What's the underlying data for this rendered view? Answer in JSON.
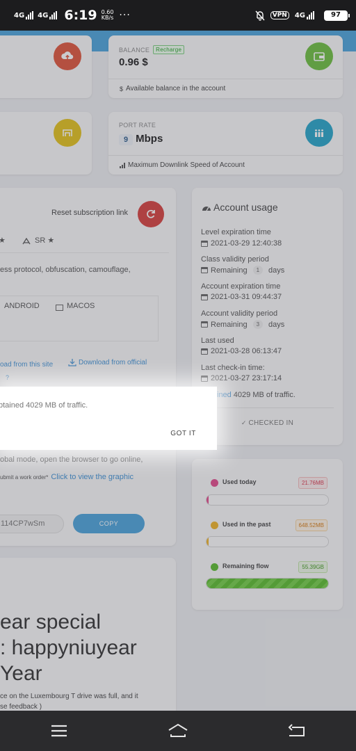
{
  "status_bar": {
    "net1": "4G",
    "net2": "4G",
    "time": "6:19",
    "speed_value": "0.60",
    "speed_unit": "KB/s",
    "more": "···",
    "vpn": "VPN",
    "net3": "4G",
    "battery": "97"
  },
  "cards": {
    "balance": {
      "label": "BALANCE",
      "recharge": "Recharge",
      "value": "0.96 $",
      "foot_icon": "$",
      "foot": "Available balance in the account",
      "icon": "wallet-icon",
      "color": "#6dbf3f"
    },
    "port_rate": {
      "label": "PORT RATE",
      "num": "9",
      "unit": "Mbps",
      "foot": "Maximum Downlink Speed of Account",
      "icon": "speed-icon",
      "color": "#26a6c9"
    },
    "top_left_icon": {
      "icon": "cloud-upload-icon",
      "color": "#e0553b"
    },
    "mid_left_icon": {
      "icon": "box-icon",
      "color": "#e3c21b"
    }
  },
  "subscription": {
    "reset_label": "Reset subscription link",
    "reset_icon_color": "#d7403d",
    "sr_star": "★",
    "sr_label": "SR ★",
    "protocol_text": "ess protocol, obfuscation, camouflage,",
    "platforms": [
      "ANDROID",
      "MACOS"
    ],
    "download_site": "oad from this site",
    "download_official": "Download from official",
    "chevron_text": "?",
    "faded_line": "...",
    "global_mode_text": "obal mode, open the browser to go online,",
    "work_order_prefix": "ubmit a work order*",
    "work_order_link": "Click to view the graphic",
    "code_text": "114CP7wSm",
    "copy_label": "COPY"
  },
  "promo": {
    "line1": "ear special",
    "line2": ": happyniuyear",
    "line3": "Year",
    "note1": "ce on the Luxembourg T drive was full, and it",
    "note2": "se feedback )"
  },
  "account_usage": {
    "title": "Account usage",
    "level_label": "Level expiration time",
    "level_value": "2021-03-29 12:40:38",
    "class_label": "Class validity period",
    "class_remaining": "Remaining",
    "class_days_num": "1",
    "class_days": "days",
    "acct_label": "Account expiration time",
    "acct_value": "2021-03-31 09:44:37",
    "acct_validity_label": "Account validity period",
    "acct_remaining": "Remaining",
    "acct_days_num": "3",
    "acct_days": "days",
    "last_used_label": "Last used",
    "last_used_value": "2021-03-28 06:13:47",
    "checkin_label": "Last check-in time:",
    "checkin_value": "2021-03-27 23:17:14",
    "obtained_prefix": "ined",
    "obtained_value": "4029 MB",
    "obtained_suffix": "of traffic.",
    "checked_in": "CHECKED IN"
  },
  "traffic": {
    "used_today_label": "Used today",
    "used_today_value": "21.76MB",
    "used_today_fraction": 0.004,
    "used_past_label": "Used in the past",
    "used_past_value": "648.52MB",
    "used_past_fraction": 0.011,
    "remaining_label": "Remaining flow",
    "remaining_value": "55.39GB",
    "remaining_fraction": 1.0,
    "colors": {
      "today": "#e34b8d",
      "past": "#f0b429",
      "remaining": "#5bbd2e"
    }
  },
  "dialog": {
    "message": "btained 4029 MB of traffic.",
    "button": "GOT IT"
  },
  "nav": {
    "menu_icon": "menu-icon",
    "home_icon": "home-icon",
    "back_icon": "back-icon"
  }
}
